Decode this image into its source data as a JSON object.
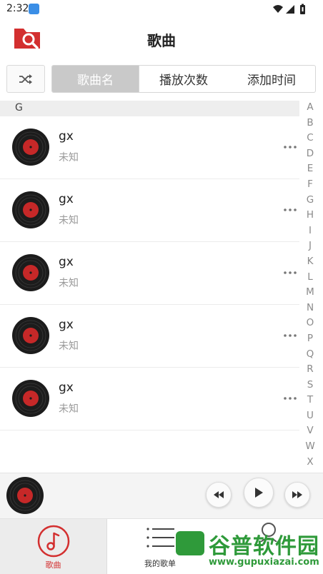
{
  "status_bar": {
    "time": "2:32"
  },
  "header": {
    "title": "歌曲"
  },
  "toolbar": {
    "sort_tabs": [
      {
        "label": "歌曲名",
        "selected": true
      },
      {
        "label": "播放次数",
        "selected": false
      },
      {
        "label": "添加时间",
        "selected": false
      }
    ]
  },
  "section": {
    "letter": "G"
  },
  "songs": [
    {
      "title": "gx",
      "artist": "未知"
    },
    {
      "title": "gx",
      "artist": "未知"
    },
    {
      "title": "gx",
      "artist": "未知"
    },
    {
      "title": "gx",
      "artist": "未知"
    },
    {
      "title": "gx",
      "artist": "未知"
    }
  ],
  "index_letters": [
    "A",
    "B",
    "C",
    "D",
    "E",
    "F",
    "G",
    "H",
    "I",
    "J",
    "K",
    "L",
    "M",
    "N",
    "O",
    "P",
    "Q",
    "R",
    "S",
    "T",
    "U",
    "V",
    "W",
    "X"
  ],
  "bottom_tabs": {
    "songs": "歌曲",
    "playlist": "我的歌单"
  },
  "watermark": {
    "title": "谷普软件园",
    "url": "www.gupuxiazai.com"
  },
  "colors": {
    "accent": "#d32f2f",
    "disc_label": "#c62828",
    "watermark": "#2f9a3a"
  }
}
